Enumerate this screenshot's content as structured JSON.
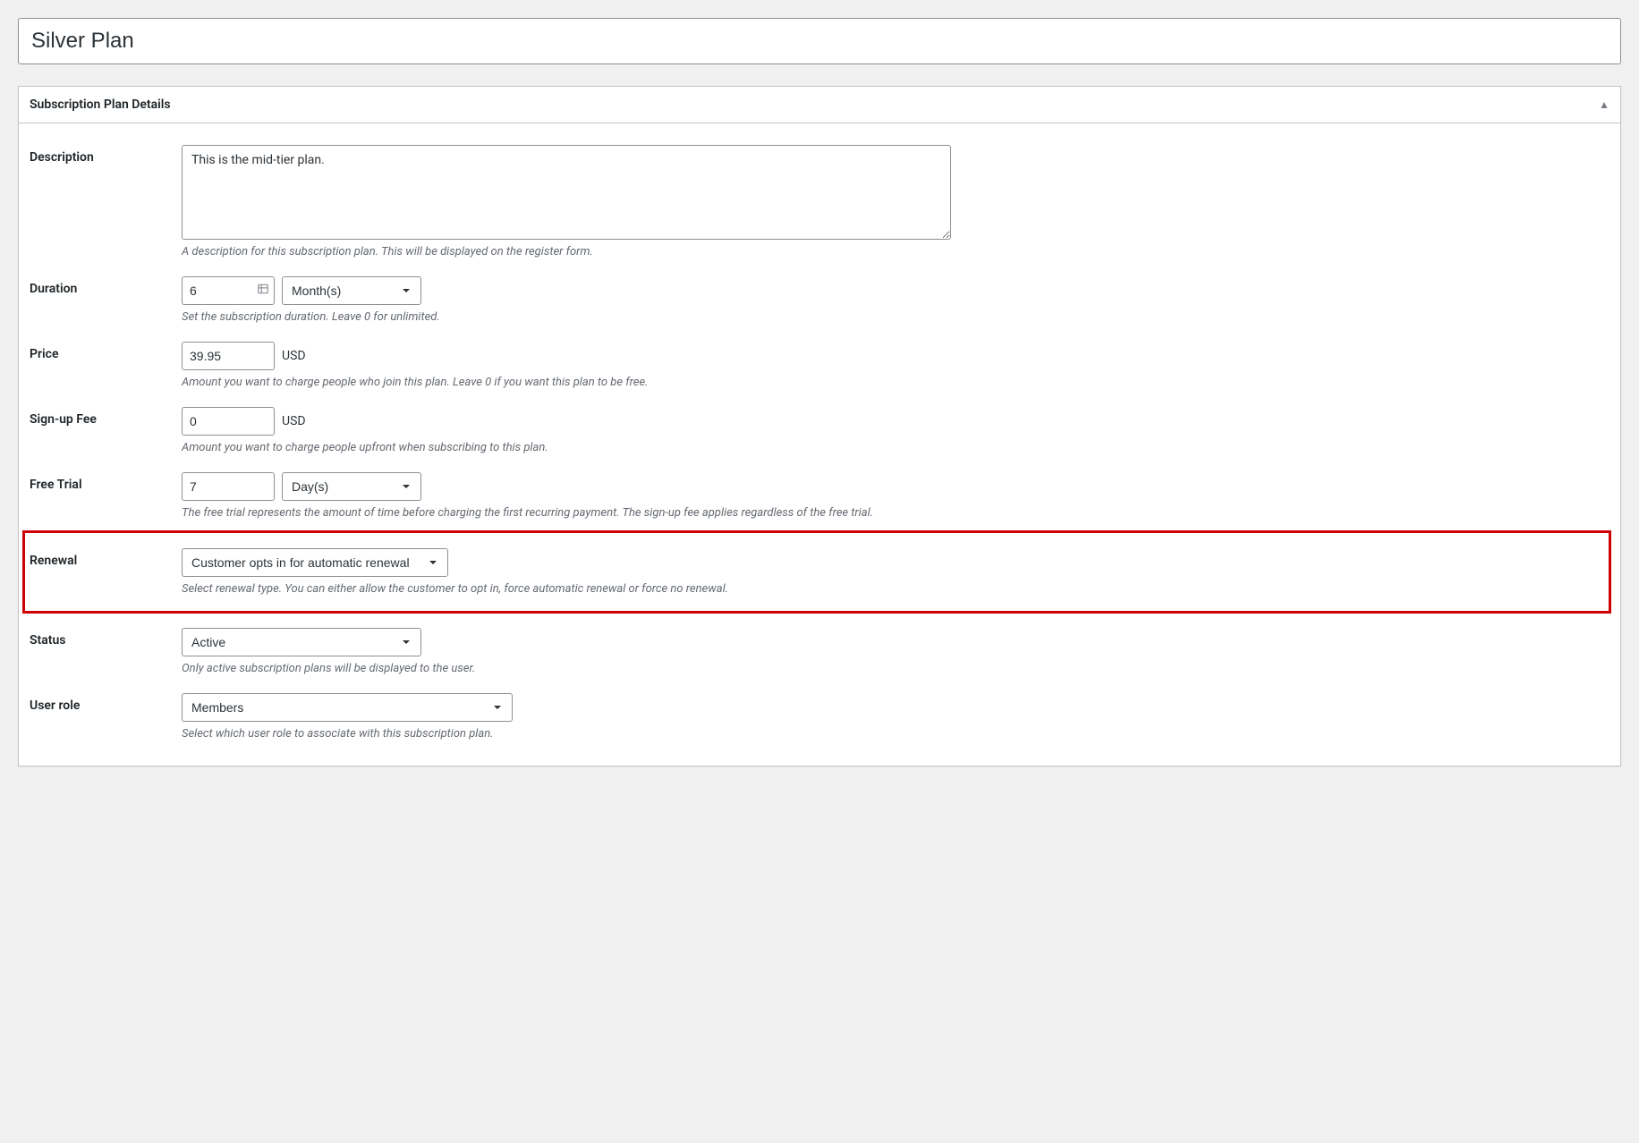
{
  "title_input": {
    "value": "Silver Plan"
  },
  "panel": {
    "heading": "Subscription Plan Details"
  },
  "description": {
    "label": "Description",
    "value": "This is the mid-tier plan.",
    "help": "A description for this subscription plan. This will be displayed on the register form."
  },
  "duration": {
    "label": "Duration",
    "value": "6",
    "unit_selected": "Month(s)",
    "help": "Set the subscription duration. Leave 0 for unlimited."
  },
  "price": {
    "label": "Price",
    "value": "39.95",
    "currency": "USD",
    "help": "Amount you want to charge people who join this plan. Leave 0 if you want this plan to be free."
  },
  "signup_fee": {
    "label": "Sign-up Fee",
    "value": "0",
    "currency": "USD",
    "help": "Amount you want to charge people upfront when subscribing to this plan."
  },
  "free_trial": {
    "label": "Free Trial",
    "value": "7",
    "unit_selected": "Day(s)",
    "help": "The free trial represents the amount of time before charging the first recurring payment. The sign-up fee applies regardless of the free trial."
  },
  "renewal": {
    "label": "Renewal",
    "selected": "Customer opts in for automatic renewal",
    "help": "Select renewal type. You can either allow the customer to opt in, force automatic renewal or force no renewal."
  },
  "status": {
    "label": "Status",
    "selected": "Active",
    "help": "Only active subscription plans will be displayed to the user."
  },
  "user_role": {
    "label": "User role",
    "selected": "Members",
    "help": "Select which user role to associate with this subscription plan."
  }
}
